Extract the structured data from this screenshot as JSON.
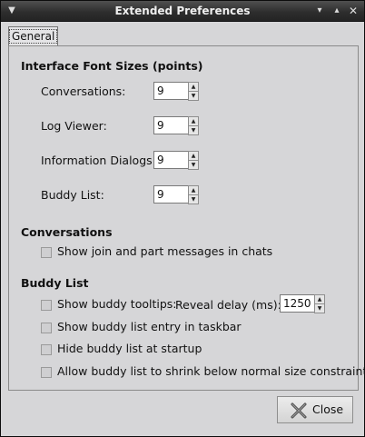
{
  "window": {
    "title": "Extended Preferences"
  },
  "tabs": [
    {
      "label": "General"
    }
  ],
  "font_sizes": {
    "heading": "Interface Font Sizes (points)",
    "rows": [
      {
        "label": "Conversations:",
        "value": "9"
      },
      {
        "label": "Log Viewer:",
        "value": "9"
      },
      {
        "label": "Information Dialogs:",
        "value": "9"
      },
      {
        "label": "Buddy List:",
        "value": "9"
      }
    ]
  },
  "conversations": {
    "heading": "Conversations",
    "option": "Show join and part messages in chats"
  },
  "buddy_list": {
    "heading": "Buddy List",
    "tooltips_label": "Show buddy tooltips:",
    "reveal_delay_label": "Reveal delay (ms):",
    "reveal_delay_value": "1250",
    "taskbar_label": "Show buddy list entry in taskbar",
    "hide_label": "Hide buddy list at startup",
    "shrink_label": "Allow buddy list to shrink below normal size constraints"
  },
  "footer": {
    "close_label": "Close"
  },
  "icons": {
    "window_menu": "chevron-down-icon",
    "minimize": "minimize-icon",
    "maximize": "maximize-icon",
    "close": "close-icon",
    "dialog_close": "close-x-icon"
  }
}
